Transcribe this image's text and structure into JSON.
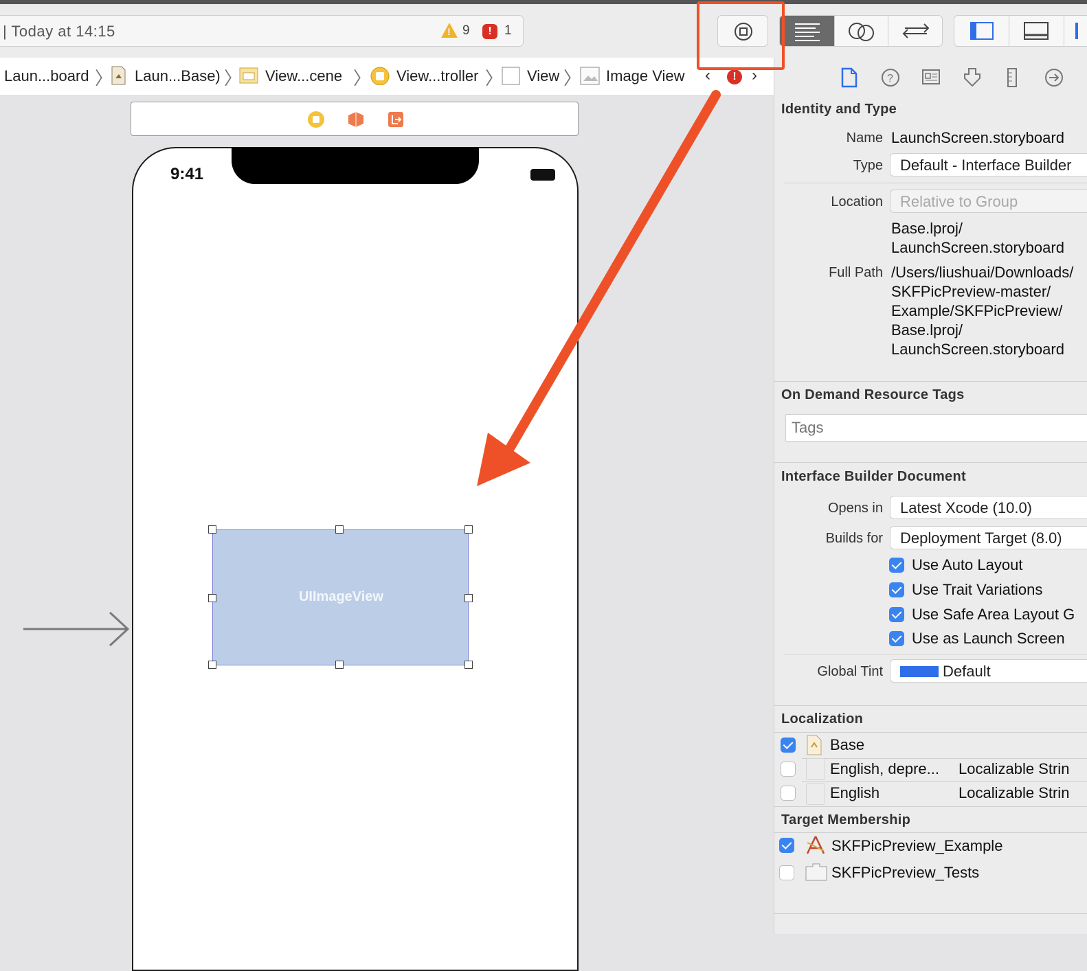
{
  "toolbar": {
    "activity_text": "| Today at 14:15",
    "warning_count": "9",
    "error_count": "1"
  },
  "breadcrumb": {
    "items": [
      "Laun...board",
      "Laun...Base)",
      "View...cene",
      "View...troller",
      "View",
      "Image View"
    ]
  },
  "canvas": {
    "status_time": "9:41",
    "image_view_label": "UIImageView"
  },
  "inspector": {
    "identity": {
      "title": "Identity and Type",
      "name_label": "Name",
      "name_value": "LaunchScreen.storyboard",
      "type_label": "Type",
      "type_value": "Default - Interface Builder",
      "location_label": "Location",
      "location_value": "Relative to Group",
      "location_path_1": "Base.lproj/",
      "location_path_2": "LaunchScreen.storyboard",
      "full_path_label": "Full Path",
      "full_path_lines": [
        "/Users/liushuai/Downloads/",
        "SKFPicPreview-master/",
        "Example/SKFPicPreview/",
        "Base.lproj/",
        "LaunchScreen.storyboard"
      ]
    },
    "tags": {
      "title": "On Demand Resource Tags",
      "placeholder": "Tags"
    },
    "ib_document": {
      "title": "Interface Builder Document",
      "opens_in_label": "Opens in",
      "opens_in_value": "Latest Xcode (10.0)",
      "builds_for_label": "Builds for",
      "builds_for_value": "Deployment Target (8.0)",
      "checkboxes": [
        {
          "label": "Use Auto Layout",
          "checked": true
        },
        {
          "label": "Use Trait Variations",
          "checked": true
        },
        {
          "label": "Use Safe Area Layout G",
          "checked": true
        },
        {
          "label": "Use as Launch Screen",
          "checked": true
        }
      ],
      "global_tint_label": "Global Tint",
      "global_tint_value": "Default",
      "tint_color": "#2f6ee8"
    },
    "localization": {
      "title": "Localization",
      "rows": [
        {
          "label": "Base",
          "checked": true,
          "kind": ""
        },
        {
          "label": "English, depre...",
          "checked": false,
          "kind": "Localizable Strin"
        },
        {
          "label": "English",
          "checked": false,
          "kind": "Localizable Strin"
        }
      ]
    },
    "membership": {
      "title": "Target Membership",
      "rows": [
        {
          "label": "SKFPicPreview_Example",
          "checked": true
        },
        {
          "label": "SKFPicPreview_Tests",
          "checked": false
        }
      ]
    }
  },
  "annotation": {
    "color": "#ee5128"
  }
}
